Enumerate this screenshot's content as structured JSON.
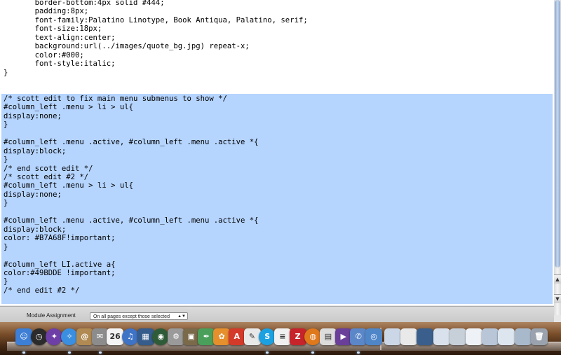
{
  "code": {
    "lines": [
      "       border-bottom:4px solid #444;",
      "       padding:8px;",
      "       font-family:Palatino Linotype, Book Antiqua, Palatino, serif;",
      "       font-size:18px;",
      "       text-align:center;",
      "       background:url(../images/quote_bg.jpg) repeat-x;",
      "       color:#000;",
      "       font-style:italic;",
      "}",
      "",
      "",
      "/* scott edit to fix main menu submenus to show */",
      "#column_left .menu > li > ul{",
      "display:none;",
      "}",
      "",
      "#column_left .menu .active, #column_left .menu .active *{",
      "display:block;",
      "}",
      "/* end scott edit */",
      "/* scott edit #2 */",
      "#column_left .menu > li > ul{",
      "display:none;",
      "}",
      "",
      "#column_left .menu .active, #column_left .menu .active *{",
      "display:block;",
      "color: #B7A68F!important;",
      "}",
      "",
      "#column_left LI.active a{",
      "color:#49BDDE !important;",
      "}",
      "/* end edit #2 */"
    ]
  },
  "module_assignment": {
    "label": "Module Assignment",
    "selected": "On all pages except those selected"
  },
  "scrollbar": {
    "up": "▲",
    "down": "▼"
  },
  "dock": {
    "icons": [
      {
        "name": "finder-icon",
        "glyph": "☺",
        "color": "#3d7fd6",
        "round": false
      },
      {
        "name": "dashboard-icon",
        "glyph": "◷",
        "color": "#2b2b2b",
        "round": true
      },
      {
        "name": "expose-icon",
        "glyph": "✦",
        "color": "#6f3fa8",
        "round": true
      },
      {
        "name": "safari-icon",
        "glyph": "✧",
        "color": "#3b8fe0",
        "round": true
      },
      {
        "name": "address-book-icon",
        "glyph": "@",
        "color": "#b08a52",
        "round": false
      },
      {
        "name": "mail-icon",
        "glyph": "✉",
        "color": "#8c8c8c",
        "round": false
      },
      {
        "name": "ical-icon",
        "glyph": "26",
        "color": "#f4f4f4",
        "round": false
      },
      {
        "name": "itunes-icon",
        "glyph": "♫",
        "color": "#3f73c6",
        "round": true
      },
      {
        "name": "spaces-icon",
        "glyph": "▦",
        "color": "#355c8a",
        "round": false
      },
      {
        "name": "time-machine-icon",
        "glyph": "◉",
        "color": "#2f5c38",
        "round": true
      },
      {
        "name": "system-preferences-icon",
        "glyph": "⚙",
        "color": "#9a9a9a",
        "round": false
      },
      {
        "name": "iphoto-icon",
        "glyph": "▣",
        "color": "#7a6a4a",
        "round": false
      },
      {
        "name": "pen-tool-icon",
        "glyph": "✒",
        "color": "#4aa05a",
        "round": false
      },
      {
        "name": "flower-icon",
        "glyph": "✿",
        "color": "#e58f2d",
        "round": false
      },
      {
        "name": "acrobat-icon",
        "glyph": "A",
        "color": "#d43a2a",
        "round": false
      },
      {
        "name": "pdf-document-icon",
        "glyph": "✎",
        "color": "#e8e8e8",
        "round": false
      },
      {
        "name": "skype-icon",
        "glyph": "S",
        "color": "#1ba1e2",
        "round": true
      },
      {
        "name": "text-document-icon",
        "glyph": "≡",
        "color": "#f0f0f0",
        "round": false
      },
      {
        "name": "filezilla-icon",
        "glyph": "Z",
        "color": "#c6242a",
        "round": false
      },
      {
        "name": "firefox-icon",
        "glyph": "◍",
        "color": "#e0781c",
        "round": true
      },
      {
        "name": "notepad-icon",
        "glyph": "▤",
        "color": "#dcdcdc",
        "round": false
      },
      {
        "name": "video-icon",
        "glyph": "▶",
        "color": "#6a3f9a",
        "round": false
      },
      {
        "name": "chat-icon",
        "glyph": "✆",
        "color": "#5b87c9",
        "round": false
      },
      {
        "name": "preview-icon",
        "glyph": "◎",
        "color": "#4f86c8",
        "round": false
      },
      {
        "name": "window-thumb-1-icon",
        "glyph": "",
        "color": "#cbd7e6",
        "round": false
      },
      {
        "name": "window-thumb-2-icon",
        "glyph": "",
        "color": "#e9e9e9",
        "round": false
      },
      {
        "name": "window-thumb-3-icon",
        "glyph": "",
        "color": "#3b5f8c",
        "round": false
      },
      {
        "name": "window-thumb-4-icon",
        "glyph": "",
        "color": "#d9e2ec",
        "round": false
      },
      {
        "name": "window-thumb-5-icon",
        "glyph": "",
        "color": "#c7cfd9",
        "round": false
      },
      {
        "name": "window-thumb-6-icon",
        "glyph": "",
        "color": "#eef2f6",
        "round": false
      },
      {
        "name": "window-thumb-7-icon",
        "glyph": "",
        "color": "#b8c6d8",
        "round": false
      },
      {
        "name": "window-thumb-8-icon",
        "glyph": "",
        "color": "#dde5ee",
        "round": false
      },
      {
        "name": "window-thumb-9-icon",
        "glyph": "",
        "color": "#a9b9cc",
        "round": false
      },
      {
        "name": "trash-icon",
        "glyph": "🗑",
        "color": "#9aa3ad",
        "round": false
      }
    ],
    "running_indicator_icons": [
      0,
      3,
      5,
      16,
      19,
      22
    ]
  }
}
